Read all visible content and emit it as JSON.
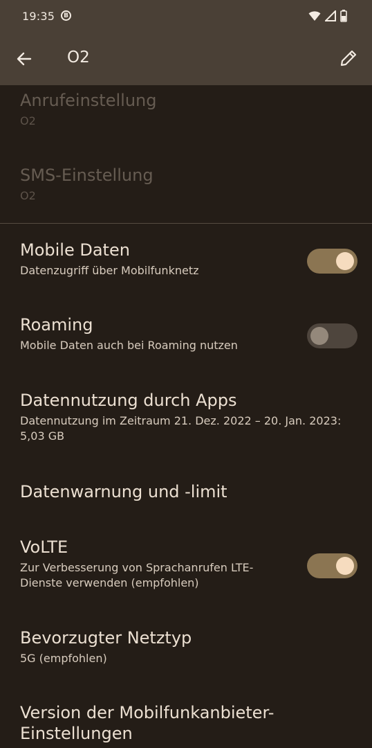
{
  "status_bar": {
    "time": "19:35",
    "badge": "B",
    "icons": [
      "wifi-icon",
      "signal-icon",
      "battery-icon"
    ]
  },
  "app_bar": {
    "title": "O2",
    "back_icon": "arrow-left-icon",
    "edit_icon": "pencil-icon"
  },
  "settings": {
    "call_setting": {
      "title": "Anrufeinstellung",
      "summary": "O2"
    },
    "sms_setting": {
      "title": "SMS-Einstellung",
      "summary": "O2"
    },
    "mobile_data": {
      "title": "Mobile Daten",
      "summary": "Datenzugriff über Mobilfunknetz",
      "enabled": true
    },
    "roaming": {
      "title": "Roaming",
      "summary": "Mobile Daten auch bei Roaming nutzen",
      "enabled": false
    },
    "app_data_usage": {
      "title": "Datennutzung durch Apps",
      "summary": "Datennutzung im Zeitraum 21. Dez. 2022 – 20. Jan. 2023: 5,03 GB"
    },
    "data_warning": {
      "title": "Datenwarnung und -limit"
    },
    "volte": {
      "title": "VoLTE",
      "summary": "Zur Verbesserung von Sprachanrufen LTE-Dienste verwenden (empfohlen)",
      "enabled": true
    },
    "preferred_network": {
      "title": "Bevorzugter Netztyp",
      "summary": "5G (empfohlen)"
    },
    "carrier_settings_version": {
      "title": "Version der Mobilfunkanbieter-Einstellungen"
    }
  },
  "colors": {
    "background": "#241d17",
    "app_bar": "#4a4036",
    "switch_on_track": "#8b7552",
    "switch_on_thumb": "#f6dcbf",
    "switch_off_track": "#4e453d",
    "switch_off_thumb": "#94887b"
  }
}
